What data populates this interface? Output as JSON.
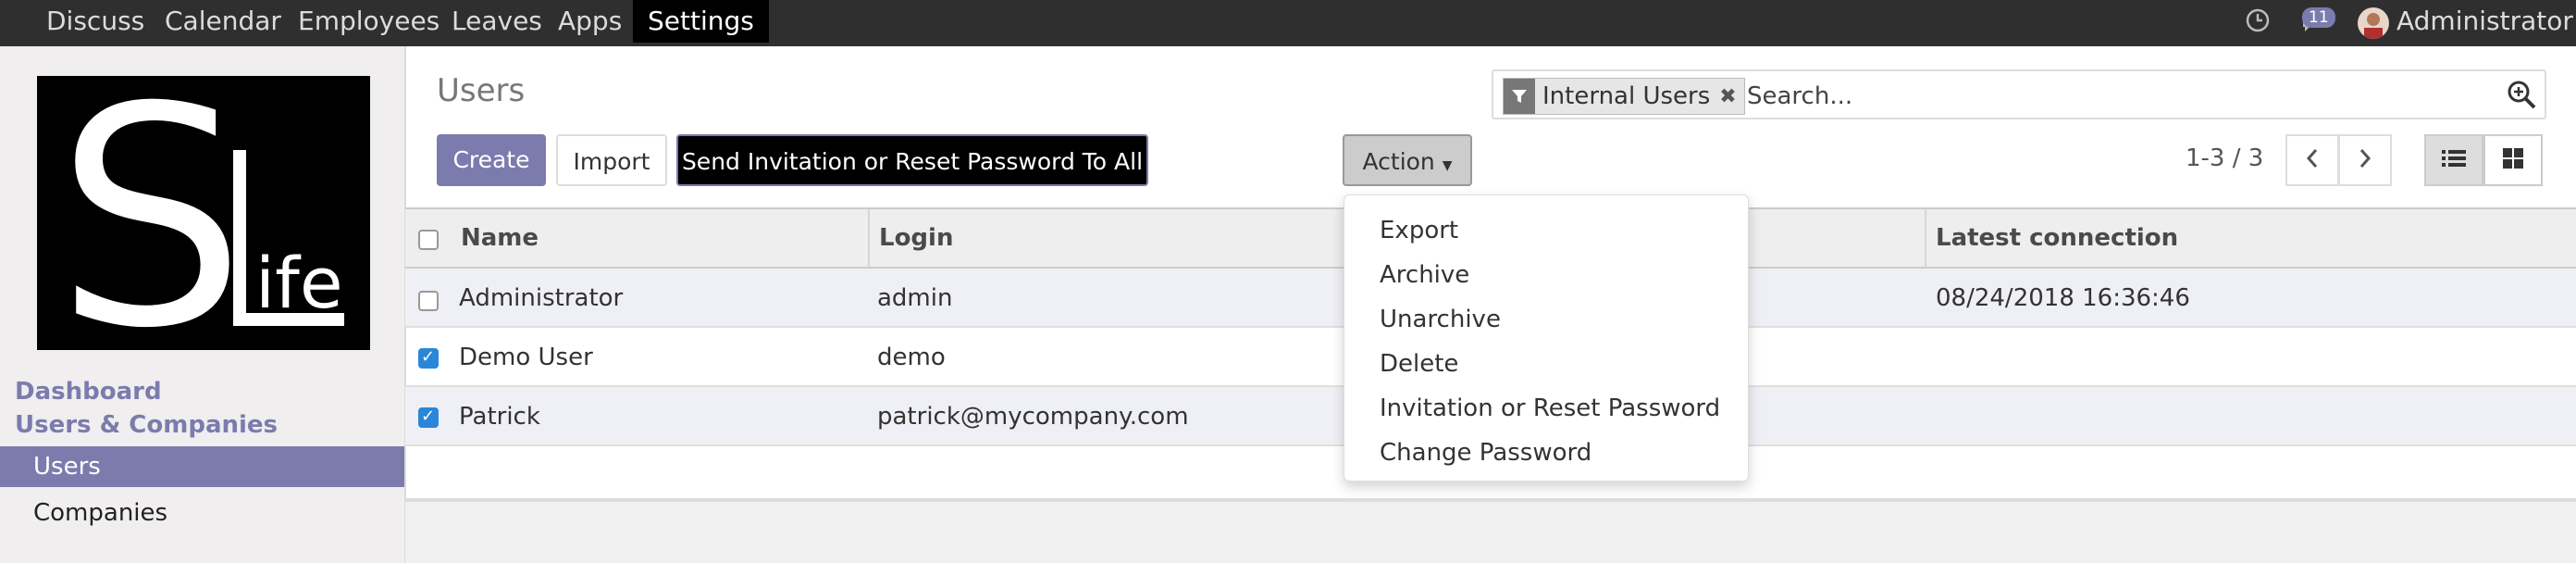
{
  "topbar": {
    "menu": [
      "Discuss",
      "Calendar",
      "Employees",
      "Leaves",
      "Apps",
      "Settings"
    ],
    "active_index": 5,
    "notifications_count": "11",
    "user_name": "Administrator"
  },
  "sidebar": {
    "logo_text_big": "S",
    "logo_text_small": "ife",
    "sections": [
      "Dashboard",
      "Users & Companies"
    ],
    "items": [
      "Users",
      "Companies"
    ]
  },
  "control": {
    "title": "Users",
    "create_label": "Create",
    "import_label": "Import",
    "send_label": "Send Invitation or Reset Password To All",
    "action_label": "Action",
    "pager": "1-3 / 3"
  },
  "search": {
    "facet": "Internal Users",
    "placeholder": "Search..."
  },
  "table": {
    "columns": [
      "Name",
      "Login",
      "Latest connection"
    ],
    "rows": [
      {
        "name": "Administrator",
        "login": "admin",
        "latest": "08/24/2018 16:36:46",
        "checked": false
      },
      {
        "name": "Demo User",
        "login": "demo",
        "latest": "",
        "checked": true
      },
      {
        "name": "Patrick",
        "login": "patrick@mycompany.com",
        "latest": "",
        "checked": true
      }
    ]
  },
  "action_menu": [
    "Export",
    "Archive",
    "Unarchive",
    "Delete",
    "Invitation or Reset Password",
    "Change Password"
  ],
  "colors": {
    "accent": "#7c7bad",
    "topbar": "#2f2f2f",
    "checkbox": "#2a86d9"
  }
}
